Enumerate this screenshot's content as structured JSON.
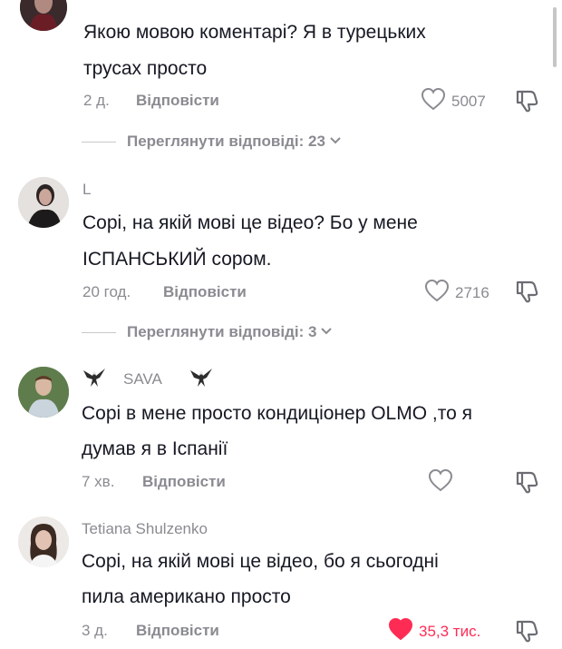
{
  "comments": [
    {
      "username": "",
      "text_lines": [
        "Якою мовою коментарі? Я в турецьких",
        "трусах просто"
      ],
      "time": "2 д.",
      "reply_label": "Відповісти",
      "likes": "5007",
      "liked": false,
      "view_replies": "Переглянути відповіді: 23"
    },
    {
      "username": "L",
      "text_lines": [
        "Сорі, на якій мові це відео? Бо у мене",
        "ІСПАНСЬКИЙ сором."
      ],
      "time": "20 год.",
      "reply_label": "Відповісти",
      "likes": "2716",
      "liked": false,
      "view_replies": "Переглянути відповіді: 3"
    },
    {
      "username": "SAVA",
      "text_lines": [
        "Сорі в мене просто кондиціонер OLMO ,то я",
        "думав я в Іспанії"
      ],
      "time": "7 хв.",
      "reply_label": "Відповісти",
      "likes": "",
      "liked": false,
      "view_replies": ""
    },
    {
      "username": "Tetiana Shulzenko",
      "text_lines": [
        "Сорі, на якій мові це відео, бо я сьогодні",
        "пила американо просто"
      ],
      "time": "3 д.",
      "reply_label": "Відповісти",
      "likes": "35,3 тис.",
      "liked": true,
      "view_replies": ""
    }
  ],
  "icons": {
    "like": "heart-outline-icon",
    "liked": "heart-filled-icon",
    "dislike": "thumbs-down-icon",
    "expand": "chevron-down-icon",
    "username_decoration": "eagle-icon"
  },
  "colors": {
    "text": "#161823",
    "secondary": "#8a8b91",
    "liked": "#fe2c55"
  }
}
